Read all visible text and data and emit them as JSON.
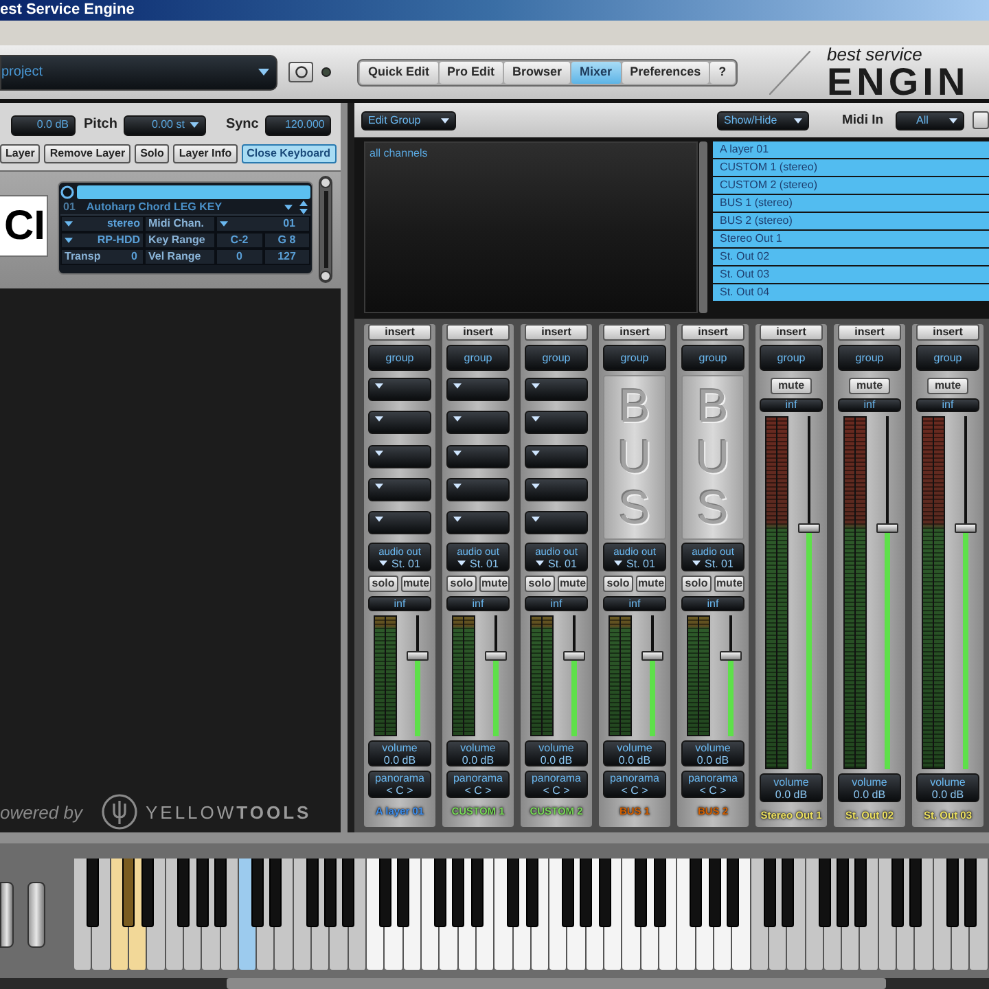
{
  "window": {
    "title": "est Service Engine"
  },
  "header": {
    "project": "project",
    "midi_led": {
      "on": false
    },
    "tabs": [
      {
        "label": "Quick Edit",
        "selected": false
      },
      {
        "label": "Pro Edit",
        "selected": false
      },
      {
        "label": "Browser",
        "selected": false
      },
      {
        "label": "Mixer",
        "selected": true
      },
      {
        "label": "Preferences",
        "selected": false
      },
      {
        "label": "?",
        "selected": false
      }
    ],
    "logo": {
      "tagline": "best service",
      "wordmark": "ENGIN"
    }
  },
  "layer_controls": {
    "volume": "0.0 dB",
    "pitch_label": "Pitch",
    "pitch": "0.00 st",
    "sync_label": "Sync",
    "sync": "120.000",
    "buttons": [
      {
        "label": "Layer",
        "active": false
      },
      {
        "label": "Remove Layer",
        "active": false
      },
      {
        "label": "Solo",
        "active": false
      },
      {
        "label": "Layer Info",
        "active": false
      },
      {
        "label": "Close Keyboard",
        "active": true
      }
    ]
  },
  "instrument": {
    "logo_text": "CI",
    "layer": {
      "number": "01",
      "name": "Autoharp Chord LEG KEY",
      "output": "stereo",
      "midi_label": "Midi Chan.",
      "midi_channel": "01",
      "mode": "RP-HDD",
      "key_label": "Key Range",
      "key_low": "C-2",
      "key_high": "G 8",
      "transp_label": "Transp",
      "transp": "0",
      "vel_label": "Vel Range",
      "vel_low": "0",
      "vel_high": "127"
    }
  },
  "branding": {
    "powered_by": "owered by",
    "logo": "YELLOW**TOOLS**"
  },
  "mixer_header": {
    "edit_group": "Edit Group",
    "show_hide": "Show/Hide",
    "midi_in_label": "Midi In",
    "midi_in": "All"
  },
  "groups": [
    {
      "label": "all channels"
    }
  ],
  "channel_list": [
    {
      "label": "A layer 01",
      "selected": true
    },
    {
      "label": "CUSTOM 1 (stereo)",
      "selected": true
    },
    {
      "label": "CUSTOM 2 (stereo)",
      "selected": true
    },
    {
      "label": "BUS 1 (stereo)",
      "selected": true
    },
    {
      "label": "BUS 2 (stereo)",
      "selected": true
    },
    {
      "label": "Stereo Out 1",
      "selected": true
    },
    {
      "label": "St. Out 02",
      "selected": true
    },
    {
      "label": "St. Out 03",
      "selected": true
    },
    {
      "label": "St. Out 04",
      "selected": true
    }
  ],
  "strips": [
    {
      "kind": "channel",
      "insert": "insert",
      "group": "group",
      "audio_out_label": "audio out",
      "audio_out": "St. 01",
      "solo": "solo",
      "mute": "mute",
      "peak": "inf",
      "level": 0.68,
      "volume_label": "volume",
      "volume": "0.0 dB",
      "pan_label": "panorama",
      "pan": "< C >",
      "name": "A layer 01",
      "color": "#3d8ff0"
    },
    {
      "kind": "channel",
      "insert": "insert",
      "group": "group",
      "audio_out_label": "audio out",
      "audio_out": "St. 01",
      "solo": "solo",
      "mute": "mute",
      "peak": "inf",
      "level": 0.68,
      "volume_label": "volume",
      "volume": "0.0 dB",
      "pan_label": "panorama",
      "pan": "< C >",
      "name": "CUSTOM 1",
      "color": "#78d858"
    },
    {
      "kind": "channel",
      "insert": "insert",
      "group": "group",
      "audio_out_label": "audio out",
      "audio_out": "St. 01",
      "solo": "solo",
      "mute": "mute",
      "peak": "inf",
      "level": 0.68,
      "volume_label": "volume",
      "volume": "0.0 dB",
      "pan_label": "panorama",
      "pan": "< C >",
      "name": "CUSTOM 2",
      "color": "#78d858"
    },
    {
      "kind": "bus",
      "insert": "insert",
      "group": "group",
      "bus_label": "BUS",
      "audio_out_label": "audio out",
      "audio_out": "St. 01",
      "solo": "solo",
      "mute": "mute",
      "peak": "inf",
      "level": 0.68,
      "volume_label": "volume",
      "volume": "0.0 dB",
      "pan_label": "panorama",
      "pan": "< C >",
      "name": "BUS 1",
      "color": "#d46000"
    },
    {
      "kind": "bus",
      "insert": "insert",
      "group": "group",
      "bus_label": "BUS",
      "audio_out_label": "audio out",
      "audio_out": "St. 01",
      "solo": "solo",
      "mute": "mute",
      "peak": "inf",
      "level": 0.68,
      "volume_label": "volume",
      "volume": "0.0 dB",
      "pan_label": "panorama",
      "pan": "< C >",
      "name": "BUS 2",
      "color": "#d46000"
    },
    {
      "kind": "output",
      "insert": "insert",
      "group": "group",
      "mute": "mute",
      "peak": "inf",
      "level": 0.69,
      "volume_label": "volume",
      "volume": "0.0 dB",
      "name": "Stereo Out 1",
      "color": "#ece060"
    },
    {
      "kind": "output",
      "insert": "insert",
      "group": "group",
      "mute": "mute",
      "peak": "inf",
      "level": 0.69,
      "volume_label": "volume",
      "volume": "0.0 dB",
      "name": "St. Out 02",
      "color": "#ece060"
    },
    {
      "kind": "output",
      "insert": "insert",
      "group": "group",
      "mute": "mute",
      "peak": "inf",
      "level": 0.69,
      "volume_label": "volume",
      "volume": "0.0 dB",
      "name": "St. Out 03",
      "color": "#ece060"
    }
  ],
  "keyboard": {
    "white_keys": [
      {
        "color": "#c6c6c6"
      },
      {
        "color": "#c6c6c6"
      },
      {
        "color": "#f2d898"
      },
      {
        "color": "#f2d898"
      },
      {
        "color": "#c6c6c6"
      },
      {
        "color": "#c6c6c6"
      },
      {
        "color": "#c6c6c6"
      },
      {
        "color": "#c6c6c6"
      },
      {
        "color": "#c6c6c6"
      },
      {
        "color": "#9ccbee"
      },
      {
        "color": "#c6c6c6"
      },
      {
        "color": "#c6c6c6"
      },
      {
        "color": "#c6c6c6"
      },
      {
        "color": "#c6c6c6"
      },
      {
        "color": "#c6c6c6"
      },
      {
        "color": "#c6c6c6"
      },
      {
        "color": "#f4f4f4"
      },
      {
        "color": "#f4f4f4"
      },
      {
        "color": "#f4f4f4"
      },
      {
        "color": "#f4f4f4"
      },
      {
        "color": "#f4f4f4"
      },
      {
        "color": "#f4f4f4"
      },
      {
        "color": "#f4f4f4"
      },
      {
        "color": "#f4f4f4"
      },
      {
        "color": "#f4f4f4"
      },
      {
        "color": "#f4f4f4"
      },
      {
        "color": "#f4f4f4"
      },
      {
        "color": "#f4f4f4"
      },
      {
        "color": "#f4f4f4"
      },
      {
        "color": "#f4f4f4"
      },
      {
        "color": "#f4f4f4"
      },
      {
        "color": "#f4f4f4"
      },
      {
        "color": "#f4f4f4"
      },
      {
        "color": "#f4f4f4"
      },
      {
        "color": "#f4f4f4"
      },
      {
        "color": "#f4f4f4"
      },
      {
        "color": "#f4f4f4"
      },
      {
        "color": "#c6c6c6"
      },
      {
        "color": "#c6c6c6"
      },
      {
        "color": "#c6c6c6"
      },
      {
        "color": "#c6c6c6"
      },
      {
        "color": "#c6c6c6"
      },
      {
        "color": "#c6c6c6"
      },
      {
        "color": "#c6c6c6"
      },
      {
        "color": "#c6c6c6"
      },
      {
        "color": "#c6c6c6"
      },
      {
        "color": "#c6c6c6"
      },
      {
        "color": "#c6c6c6"
      },
      {
        "color": "#c6c6c6"
      },
      {
        "color": "#c6c6c6"
      }
    ],
    "black_keys": [
      {
        "color": "#111111"
      },
      {
        "color": "#7a5c20"
      },
      {
        "color": "#111111"
      },
      {
        "color": "#111111"
      },
      {
        "color": "#111111"
      },
      {
        "color": "#111111"
      },
      {
        "color": "#111111"
      },
      {
        "color": "#111111"
      },
      {
        "color": "#111111"
      },
      {
        "color": "#111111"
      },
      {
        "color": "#111111"
      },
      {
        "color": "#111111"
      },
      {
        "color": "#111111"
      },
      {
        "color": "#111111"
      },
      {
        "color": "#111111"
      },
      {
        "color": "#111111"
      },
      {
        "color": "#111111"
      },
      {
        "color": "#111111"
      },
      {
        "color": "#111111"
      },
      {
        "color": "#111111"
      },
      {
        "color": "#111111"
      },
      {
        "color": "#111111"
      },
      {
        "color": "#111111"
      },
      {
        "color": "#111111"
      },
      {
        "color": "#111111"
      },
      {
        "color": "#111111"
      },
      {
        "color": "#111111"
      },
      {
        "color": "#111111"
      },
      {
        "color": "#111111"
      },
      {
        "color": "#111111"
      },
      {
        "color": "#111111"
      },
      {
        "color": "#111111"
      },
      {
        "color": "#111111"
      },
      {
        "color": "#111111"
      },
      {
        "color": "#111111"
      }
    ]
  }
}
